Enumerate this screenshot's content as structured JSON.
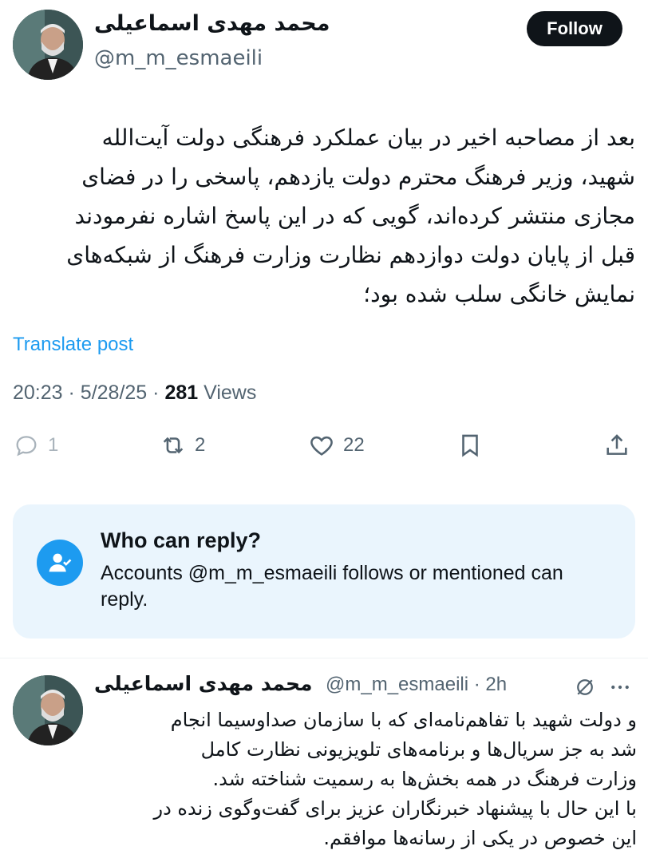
{
  "post": {
    "author_name": "محمد مهدی اسماعیلی",
    "author_handle": "@m_m_esmaeili",
    "follow_label": "Follow",
    "text_lines": [
      "بعد از مصاحبه اخیر در بیان عملکرد فرهنگی دولت آیت‌الله",
      "شهید، وزیر فرهنگ محترم دولت یازدهم، پاسخی را در فضای",
      "مجازی منتشر کرده‌اند، گویی که در این پاسخ اشاره نفرمودند",
      "قبل از پایان دولت دوازدهم نظارت وزارت فرهنگ از شبکه‌های",
      "نمایش خانگی سلب شده بود؛"
    ],
    "translate_label": "Translate post",
    "time": "20:23",
    "date": "5/28/25",
    "views_count": "281",
    "views_label": "Views",
    "separator": "·"
  },
  "actions": {
    "reply_count": "1",
    "repost_count": "2",
    "like_count": "22"
  },
  "reply_restriction": {
    "title": "Who can reply?",
    "description": "Accounts @m_m_esmaeili follows or mentioned can reply."
  },
  "reply": {
    "author_name": "محمد مهدی اسماعیلی",
    "meta": "@m_m_esmaeili · 2h",
    "text_lines": [
      "و دولت شهید با تفاهم‌نامه‌ای که با سازمان صداوسیما انجام",
      "شد به جز سریال‌ها و برنامه‌های تلویزیونی نظارت کامل",
      "وزارت فرهنگ در همه بخش‌ها به رسمیت شناخته شد.",
      "با این حال با پیشنهاد خبرنگاران عزیز برای گفت‌وگوی زنده در",
      "این خصوص در یکی از رسانه‌ها موافقم."
    ]
  },
  "colors": {
    "accent": "#1d9bf0",
    "text_secondary": "#536471",
    "reply_box_bg": "#eaf5fd"
  },
  "icons": [
    "reply-icon",
    "repost-icon",
    "like-icon",
    "bookmark-icon",
    "share-icon",
    "people-check-icon",
    "grok-icon",
    "more-icon"
  ]
}
